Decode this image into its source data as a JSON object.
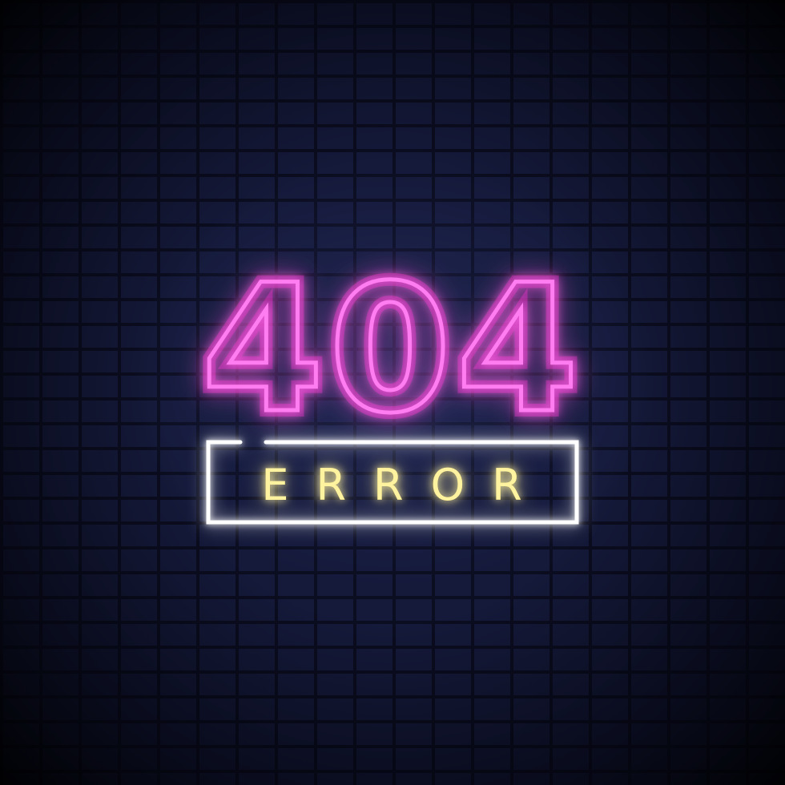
{
  "sign": {
    "number": "404",
    "label": "ERROR"
  },
  "colors": {
    "number_neon": "#ff7df0",
    "number_glow": "#ff2fd6",
    "label_neon": "#fff3a0",
    "label_glow": "#ffc800",
    "frame_neon": "#ffffff",
    "wall": "#151a3b",
    "mortar": "#0b0d20"
  }
}
